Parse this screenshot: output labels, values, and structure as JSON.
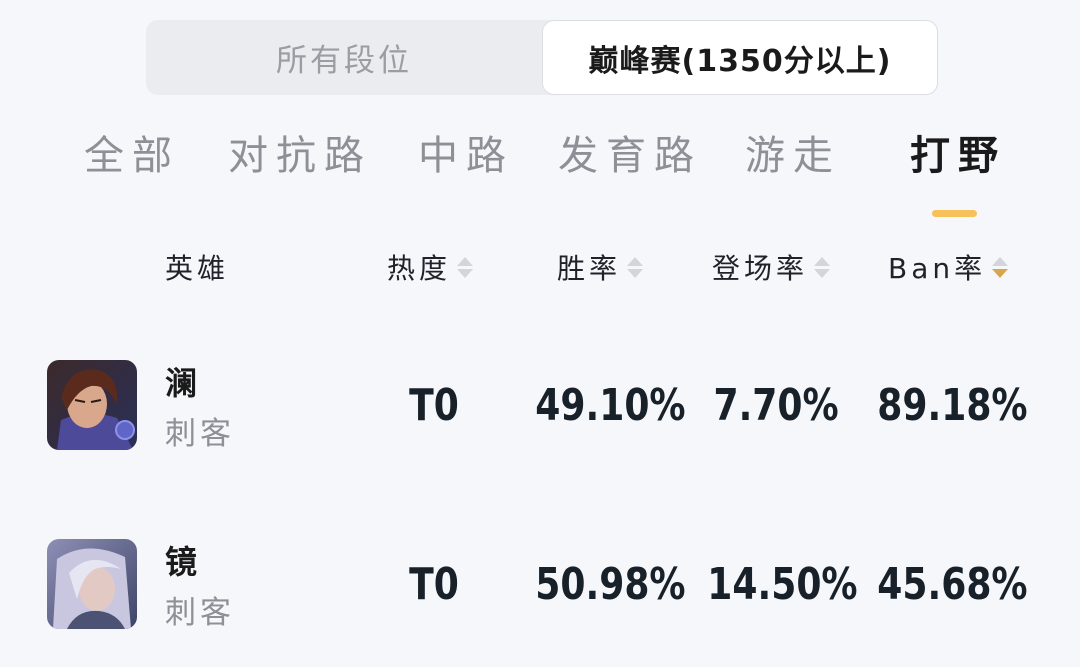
{
  "rank_filter": {
    "options": [
      "所有段位",
      "巅峰赛(1350分以上)"
    ],
    "selected": "巅峰赛(1350分以上)"
  },
  "lane_tabs": {
    "items": [
      "全部",
      "对抗路",
      "中路",
      "发育路",
      "游走",
      "打野"
    ],
    "active": "打野",
    "indicator_color": "#f6c15b"
  },
  "table": {
    "headers": {
      "hero": "英雄",
      "heat": "热度",
      "win_rate": "胜率",
      "pick_rate": "登场率",
      "ban_rate": "Ban率"
    },
    "sorted_by": "ban_rate",
    "sort_direction": "desc",
    "rows": [
      {
        "name": "澜",
        "role": "刺客",
        "tier": "T0",
        "win_rate": "49.10%",
        "pick_rate": "7.70%",
        "ban_rate": "89.18%",
        "avatar_icon": "hero-portrait-lan"
      },
      {
        "name": "镜",
        "role": "刺客",
        "tier": "T0",
        "win_rate": "50.98%",
        "pick_rate": "14.50%",
        "ban_rate": "45.68%",
        "avatar_icon": "hero-portrait-jing"
      }
    ]
  },
  "colors": {
    "background": "#f6f7fb",
    "sort_active": "#d6a64d",
    "sort_inactive": "#d3d5d9",
    "text_primary": "#1a1a1a",
    "text_secondary": "#8d9096"
  }
}
